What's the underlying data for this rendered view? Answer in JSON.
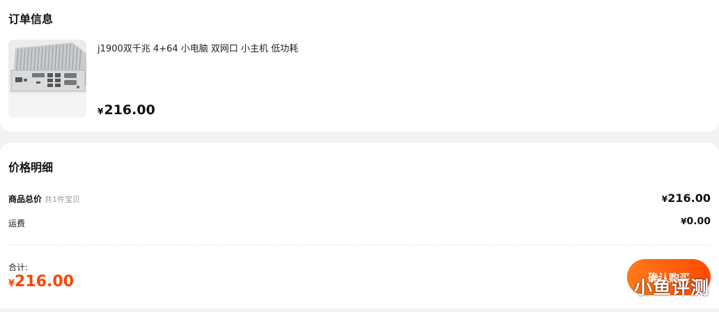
{
  "order": {
    "title": "订单信息",
    "product": {
      "image_icon": "mini-pc-product-image",
      "title": "j1900双千兆 4+64 小电脑 双网口 小主机 低功耗",
      "currency": "¥",
      "price": "216.00"
    }
  },
  "price_detail": {
    "title": "价格明细",
    "goods_total_label": "商品总价",
    "goods_count": "共1件宝贝",
    "goods_total_currency": "¥",
    "goods_total_value": "216.00",
    "shipping_label": "运费",
    "shipping_currency": "¥",
    "shipping_value": "0.00",
    "total_label": "合计:",
    "total_currency": "¥",
    "total_value": "216.00",
    "buy_button": "确认购买"
  },
  "watermark": "小鱼评测",
  "colors": {
    "accent": "#ff4400",
    "button_start": "#ff7a1a",
    "button_end": "#ff4a00",
    "background": "#f2f3f5"
  }
}
